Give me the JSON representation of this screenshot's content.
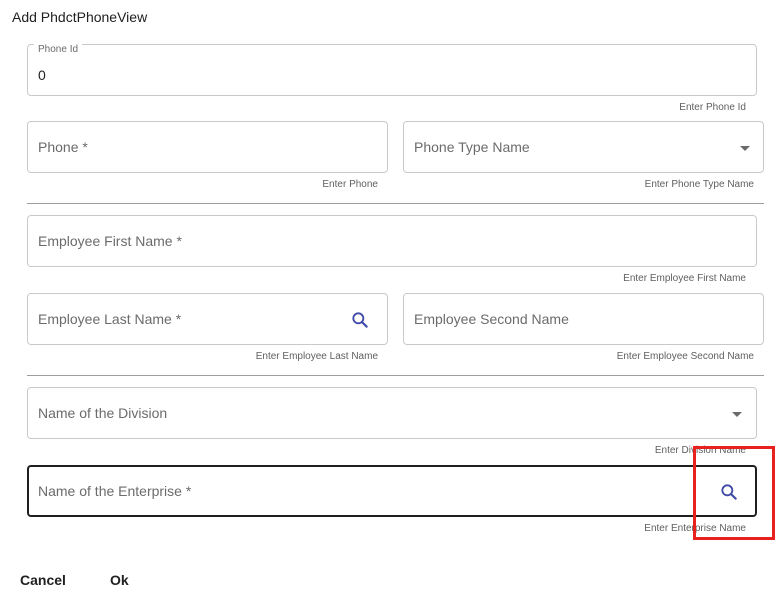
{
  "dialog": {
    "title": "Add PhdctPhoneView"
  },
  "fields": {
    "phone_id": {
      "label": "Phone Id",
      "value": "0",
      "hint": "Enter Phone Id"
    },
    "phone": {
      "placeholder": "Phone *",
      "hint": "Enter Phone"
    },
    "phone_type_name": {
      "placeholder": "Phone Type Name",
      "hint": "Enter Phone Type Name"
    },
    "employee_first_name": {
      "placeholder": "Employee First Name *",
      "hint": "Enter Employee First Name"
    },
    "employee_last_name": {
      "placeholder": "Employee Last Name *",
      "hint": "Enter Employee Last Name"
    },
    "employee_second_name": {
      "placeholder": "Employee Second Name",
      "hint": "Enter Employee Second Name"
    },
    "division_name": {
      "placeholder": "Name of the Division",
      "hint": "Enter Division Name"
    },
    "enterprise_name": {
      "placeholder": "Name of the Enterprise *",
      "hint": "Enter Enterprise Name"
    }
  },
  "actions": {
    "cancel_label": "Cancel",
    "ok_label": "Ok"
  },
  "colors": {
    "search_icon": "#3f4aa8",
    "highlight": "#e8201e",
    "focused_border": "#1f1f1f"
  }
}
